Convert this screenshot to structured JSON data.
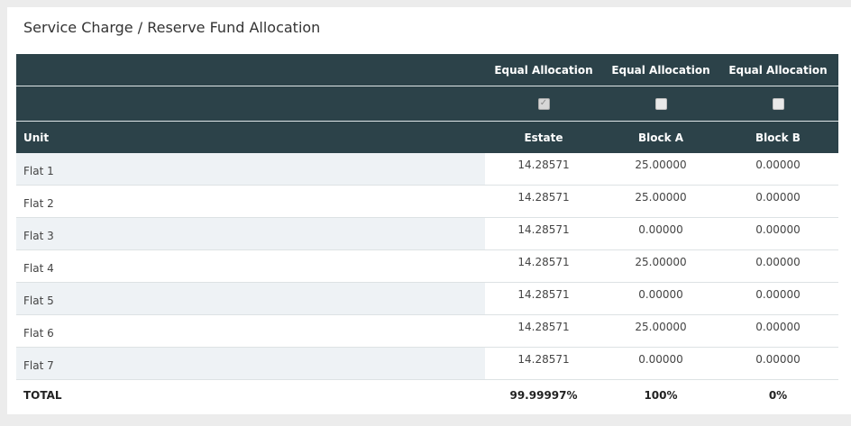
{
  "panel": {
    "title": "Service Charge / Reserve Fund Allocation"
  },
  "table": {
    "allocation_label": "Equal Allocation",
    "unit_header": "Unit",
    "columns": [
      {
        "name": "Estate",
        "equal_allocation_checked": true
      },
      {
        "name": "Block A",
        "equal_allocation_checked": false
      },
      {
        "name": "Block B",
        "equal_allocation_checked": false
      }
    ],
    "rows": [
      {
        "unit": "Flat 1",
        "values": [
          "14.28571",
          "25.00000",
          "0.00000"
        ]
      },
      {
        "unit": "Flat 2",
        "values": [
          "14.28571",
          "25.00000",
          "0.00000"
        ]
      },
      {
        "unit": "Flat 3",
        "values": [
          "14.28571",
          "0.00000",
          "0.00000"
        ]
      },
      {
        "unit": "Flat 4",
        "values": [
          "14.28571",
          "25.00000",
          "0.00000"
        ]
      },
      {
        "unit": "Flat 5",
        "values": [
          "14.28571",
          "0.00000",
          "0.00000"
        ]
      },
      {
        "unit": "Flat 6",
        "values": [
          "14.28571",
          "25.00000",
          "0.00000"
        ]
      },
      {
        "unit": "Flat 7",
        "values": [
          "14.28571",
          "0.00000",
          "0.00000"
        ]
      }
    ],
    "total": {
      "label": "TOTAL",
      "values": [
        "99.99997%",
        "100%",
        "0%"
      ]
    }
  },
  "colors": {
    "header_bg": "#2c4249",
    "stripe_bg": "#eef2f5",
    "page_bg": "#ececec"
  }
}
